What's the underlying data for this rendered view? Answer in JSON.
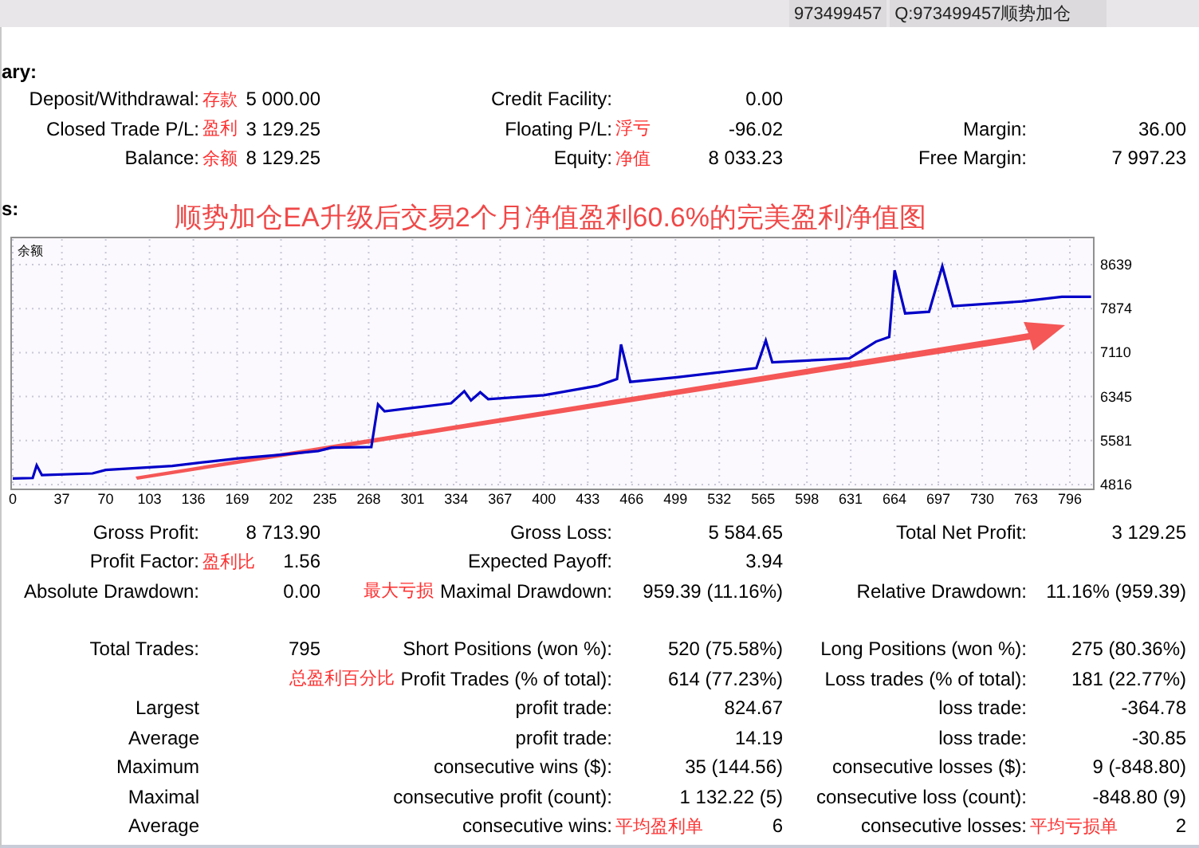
{
  "header": {
    "account": "973499457",
    "name": "Q:973499457顺势加仓"
  },
  "summary": {
    "heading": "ary:",
    "rows": [
      {
        "label_1": {
          "text": "Deposit/Withdrawal:"
        },
        "value_1": {
          "text": "5 000.00",
          "note": "存款"
        },
        "label_2": {
          "text": "Credit Facility:"
        },
        "value_2": {
          "text": "0.00"
        }
      },
      {
        "label_1": {
          "text": "Closed Trade P/L:"
        },
        "value_1": {
          "text": "3 129.25",
          "note": "盈利"
        },
        "label_2": {
          "text": "Floating P/L:"
        },
        "value_2": {
          "text": "-96.02",
          "note": "浮亏"
        },
        "label_3": {
          "text": "Margin:"
        },
        "value_3": {
          "text": "36.00"
        }
      },
      {
        "label_1": {
          "text": "Balance:"
        },
        "value_1": {
          "text": "8 129.25",
          "note": "余额"
        },
        "label_2": {
          "text": "Equity:"
        },
        "value_2": {
          "text": "8 033.23",
          "note": "净值"
        },
        "label_3": {
          "text": "Free Margin:"
        },
        "value_3": {
          "text": "7 997.23"
        }
      }
    ]
  },
  "chart_section": {
    "heading": "s:",
    "caption": "顺势加仓EA升级后交易2个月净值盈利60.6%的完美盈利净值图",
    "chart_data": {
      "type": "line",
      "grid": true,
      "x": [
        0,
        15,
        18,
        22,
        60,
        70,
        120,
        150,
        170,
        200,
        230,
        240,
        270,
        275,
        280,
        330,
        340,
        345,
        352,
        358,
        400,
        440,
        455,
        458,
        465,
        500,
        560,
        567,
        572,
        630,
        650,
        660,
        664,
        672,
        690,
        700,
        708,
        760,
        790,
        812
      ],
      "xticks": [
        0,
        37,
        70,
        103,
        136,
        169,
        202,
        235,
        268,
        301,
        334,
        367,
        400,
        433,
        466,
        499,
        532,
        565,
        598,
        631,
        664,
        697,
        730,
        763,
        796
      ],
      "yticks": [
        4816,
        5581,
        6345,
        7110,
        7874,
        8639
      ],
      "xlim": [
        0,
        814
      ],
      "ylim": [
        4733,
        9110
      ],
      "series": [
        {
          "name": "余额",
          "color": "#0000c8",
          "values": [
            4920,
            4930,
            5150,
            4980,
            5010,
            5070,
            5140,
            5220,
            5270,
            5330,
            5400,
            5460,
            5470,
            6210,
            6090,
            6230,
            6440,
            6280,
            6420,
            6300,
            6370,
            6530,
            6650,
            7250,
            6600,
            6680,
            6840,
            7320,
            6940,
            7010,
            7300,
            7380,
            8540,
            7790,
            7820,
            8610,
            7920,
            8000,
            8080,
            8080
          ]
        }
      ]
    }
  },
  "stats": {
    "groups": [
      [
        {
          "label_1": {
            "text": "Gross Profit:"
          },
          "value_1": {
            "text": "8 713.90"
          },
          "label_2": {
            "text": "Gross Loss:"
          },
          "value_2": {
            "text": "5 584.65"
          },
          "label_3": {
            "text": "Total Net Profit:"
          },
          "value_3": {
            "text": "3 129.25"
          }
        },
        {
          "label_1": {
            "text": "Profit Factor:"
          },
          "value_1": {
            "text": "1.56",
            "note": "盈利比"
          },
          "label_2": {
            "text": "Expected Payoff:"
          },
          "value_2": {
            "text": "3.94"
          }
        },
        {
          "label_1": {
            "text": "Absolute Drawdown:"
          },
          "value_1": {
            "text": "0.00"
          },
          "label_2": {
            "text": "Maximal Drawdown:",
            "note": "最大亏损"
          },
          "value_2": {
            "text": "959.39 (11.16%)"
          },
          "label_3": {
            "text": "Relative Drawdown:"
          },
          "value_3": {
            "text": "11.16% (959.39)"
          }
        }
      ],
      [
        {
          "label_1": {
            "text": "Total Trades:"
          },
          "value_1": {
            "text": "795"
          },
          "label_2": {
            "text": "Short Positions (won %):"
          },
          "value_2": {
            "text": "520 (75.58%)"
          },
          "label_3": {
            "text": "Long Positions (won %):"
          },
          "value_3": {
            "text": "275 (80.36%)"
          }
        },
        {
          "label_2": {
            "text": "Profit Trades (% of total):",
            "note": "总盈利百分比"
          },
          "value_2": {
            "text": "614 (77.23%)"
          },
          "label_3": {
            "text": "Loss trades (% of total):"
          },
          "value_3": {
            "text": "181 (22.77%)"
          }
        },
        {
          "label_1": {
            "text": "Largest"
          },
          "label_2": {
            "text": "profit trade:"
          },
          "value_2": {
            "text": "824.67"
          },
          "label_3": {
            "text": "loss trade:"
          },
          "value_3": {
            "text": "-364.78"
          }
        },
        {
          "label_1": {
            "text": "Average"
          },
          "label_2": {
            "text": "profit trade:"
          },
          "value_2": {
            "text": "14.19"
          },
          "label_3": {
            "text": "loss trade:"
          },
          "value_3": {
            "text": "-30.85"
          }
        },
        {
          "label_1": {
            "text": "Maximum"
          },
          "label_2": {
            "text": "consecutive wins ($):"
          },
          "value_2": {
            "text": "35 (144.56)"
          },
          "label_3": {
            "text": "consecutive losses ($):"
          },
          "value_3": {
            "text": "9 (-848.80)"
          }
        },
        {
          "label_1": {
            "text": "Maximal"
          },
          "label_2": {
            "text": "consecutive profit (count):"
          },
          "value_2": {
            "text": "1 132.22 (5)"
          },
          "label_3": {
            "text": "consecutive loss (count):"
          },
          "value_3": {
            "text": "-848.80 (9)"
          }
        },
        {
          "label_1": {
            "text": "Average"
          },
          "label_2": {
            "text": "consecutive wins:"
          },
          "value_2": {
            "text": "6",
            "note": "平均盈利单"
          },
          "label_3": {
            "text": "consecutive losses:"
          },
          "value_3": {
            "text": "2",
            "note": "平均亏损单"
          }
        }
      ]
    ]
  }
}
